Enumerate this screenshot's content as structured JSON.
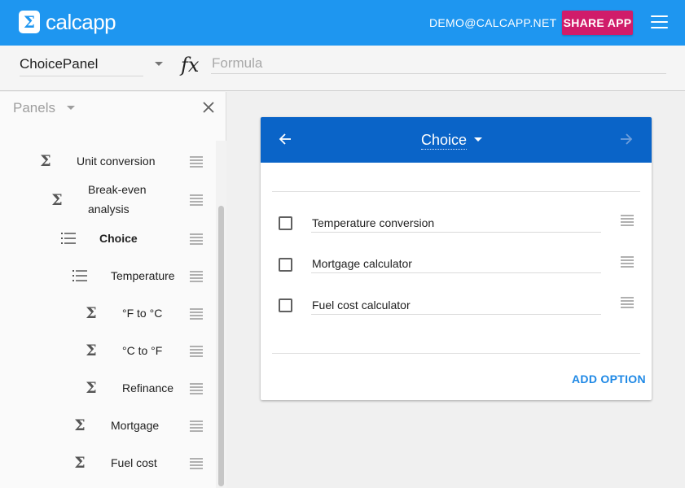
{
  "app": {
    "logo_glyph": "Σ",
    "brand": "calcapp",
    "user_email": "DEMO@CALCAPP.NET",
    "share_label": "SHARE APP",
    "colors": {
      "appbar": "#1e96f0",
      "share_button": "#d01c6a",
      "card_header": "#0a64c8",
      "accent_link": "#1e88e5"
    }
  },
  "toolbar": {
    "panel_select_value": "ChoicePanel",
    "formula_icon": "fx",
    "formula_placeholder": "Formula",
    "formula_value": ""
  },
  "sidebar": {
    "title": "Panels",
    "items": [
      {
        "icon": "sigma-icon",
        "label": "Unit conversion",
        "bold": false
      },
      {
        "icon": "sigma-icon",
        "label": "Break-even analysis",
        "bold": false
      },
      {
        "icon": "list-icon",
        "label": "Choice",
        "bold": true,
        "selected": true
      },
      {
        "icon": "list-icon",
        "label": "Temperature",
        "bold": false
      },
      {
        "icon": "sigma-icon",
        "label": "°F to °C",
        "bold": false
      },
      {
        "icon": "sigma-icon",
        "label": "°C to °F",
        "bold": false
      },
      {
        "icon": "sigma-icon",
        "label": "Refinance",
        "bold": false
      },
      {
        "icon": "sigma-icon",
        "label": "Mortgage",
        "bold": false
      },
      {
        "icon": "sigma-icon",
        "label": "Fuel cost",
        "bold": false
      }
    ]
  },
  "card": {
    "title": "Choice",
    "options": [
      {
        "label": "Temperature conversion",
        "checked": false
      },
      {
        "label": "Mortgage calculator",
        "checked": false
      },
      {
        "label": "Fuel cost calculator",
        "checked": false
      }
    ],
    "add_option_label": "ADD OPTION"
  }
}
